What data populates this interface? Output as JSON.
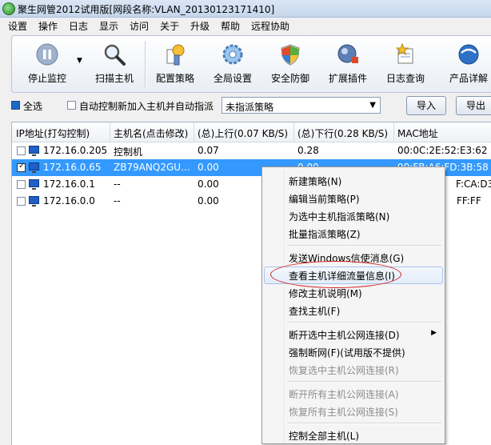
{
  "window": {
    "title": "聚生网管2012试用版[网段名称:VLAN_20130123171410]"
  },
  "menubar": [
    "设置",
    "操作",
    "日志",
    "显示",
    "访问",
    "关于",
    "升级",
    "帮助",
    "远程协助"
  ],
  "toolbar": {
    "stop_monitor": "停止监控",
    "scan_host": "扫描主机",
    "config_policy": "配置策略",
    "global_settings": "全局设置",
    "security": "安全防御",
    "plugins": "扩展插件",
    "log_query": "日志查询",
    "product_detail": "产品详解"
  },
  "filter": {
    "select_all": "全选",
    "auto_control": "自动控制新加入主机并自动指派",
    "policy_value": "未指派策略",
    "import": "导入",
    "export": "导出"
  },
  "table": {
    "headers": [
      "IP地址(打勾控制)",
      "主机名(点击修改)",
      "(总)上行(0.07 KB/S)",
      "(总)下行(0.28 KB/S)",
      "MAC地址"
    ],
    "rows": [
      {
        "checked": false,
        "ip": "172.16.0.205",
        "host": "控制机",
        "up": "0.07",
        "down": "0.28",
        "mac": "00:0C:2E:52:E3:62",
        "selected": false
      },
      {
        "checked": true,
        "ip": "172.16.0.65",
        "host": "ZB79ANQ2GU...",
        "up": "0.00",
        "down": "0.00",
        "mac": "90:FB:A6:FD:3B:58",
        "selected": true
      },
      {
        "checked": false,
        "ip": "172.16.0.1",
        "host": "--",
        "up": "0.00",
        "down": "",
        "mac": "F:CA:D3",
        "selected": false
      },
      {
        "checked": false,
        "ip": "172.16.0.0",
        "host": "--",
        "up": "0.00",
        "down": "",
        "mac": "FF:FF",
        "selected": false
      }
    ]
  },
  "context_menu": {
    "items": [
      {
        "label": "新建策略(N)",
        "disabled": false
      },
      {
        "label": "编辑当前策略(P)",
        "disabled": false
      },
      {
        "label": "为选中主机指派策略(N)",
        "disabled": false
      },
      {
        "label": "批量指派策略(Z)",
        "disabled": false
      },
      {
        "label": "发送Windows信使消息(G)",
        "disabled": false
      },
      {
        "label": "查看主机详细流量信息(I)",
        "disabled": false,
        "highlighted": true
      },
      {
        "label": "修改主机说明(M)",
        "disabled": false
      },
      {
        "label": "查找主机(F)",
        "disabled": false
      },
      {
        "label": "断开选中主机公网连接(D)",
        "disabled": false,
        "submenu": true
      },
      {
        "label": "强制断网(F)(试用版不提供)",
        "disabled": false
      },
      {
        "label": "恢复选中主机公网连接(R)",
        "disabled": true
      },
      {
        "label": "断开所有主机公网连接(A)",
        "disabled": true
      },
      {
        "label": "恢复所有主机公网连接(S)",
        "disabled": true
      },
      {
        "label": "控制全部主机(L)",
        "disabled": false
      }
    ]
  },
  "colors": {
    "selection": "#3399ff",
    "annotation": "#d42020"
  }
}
